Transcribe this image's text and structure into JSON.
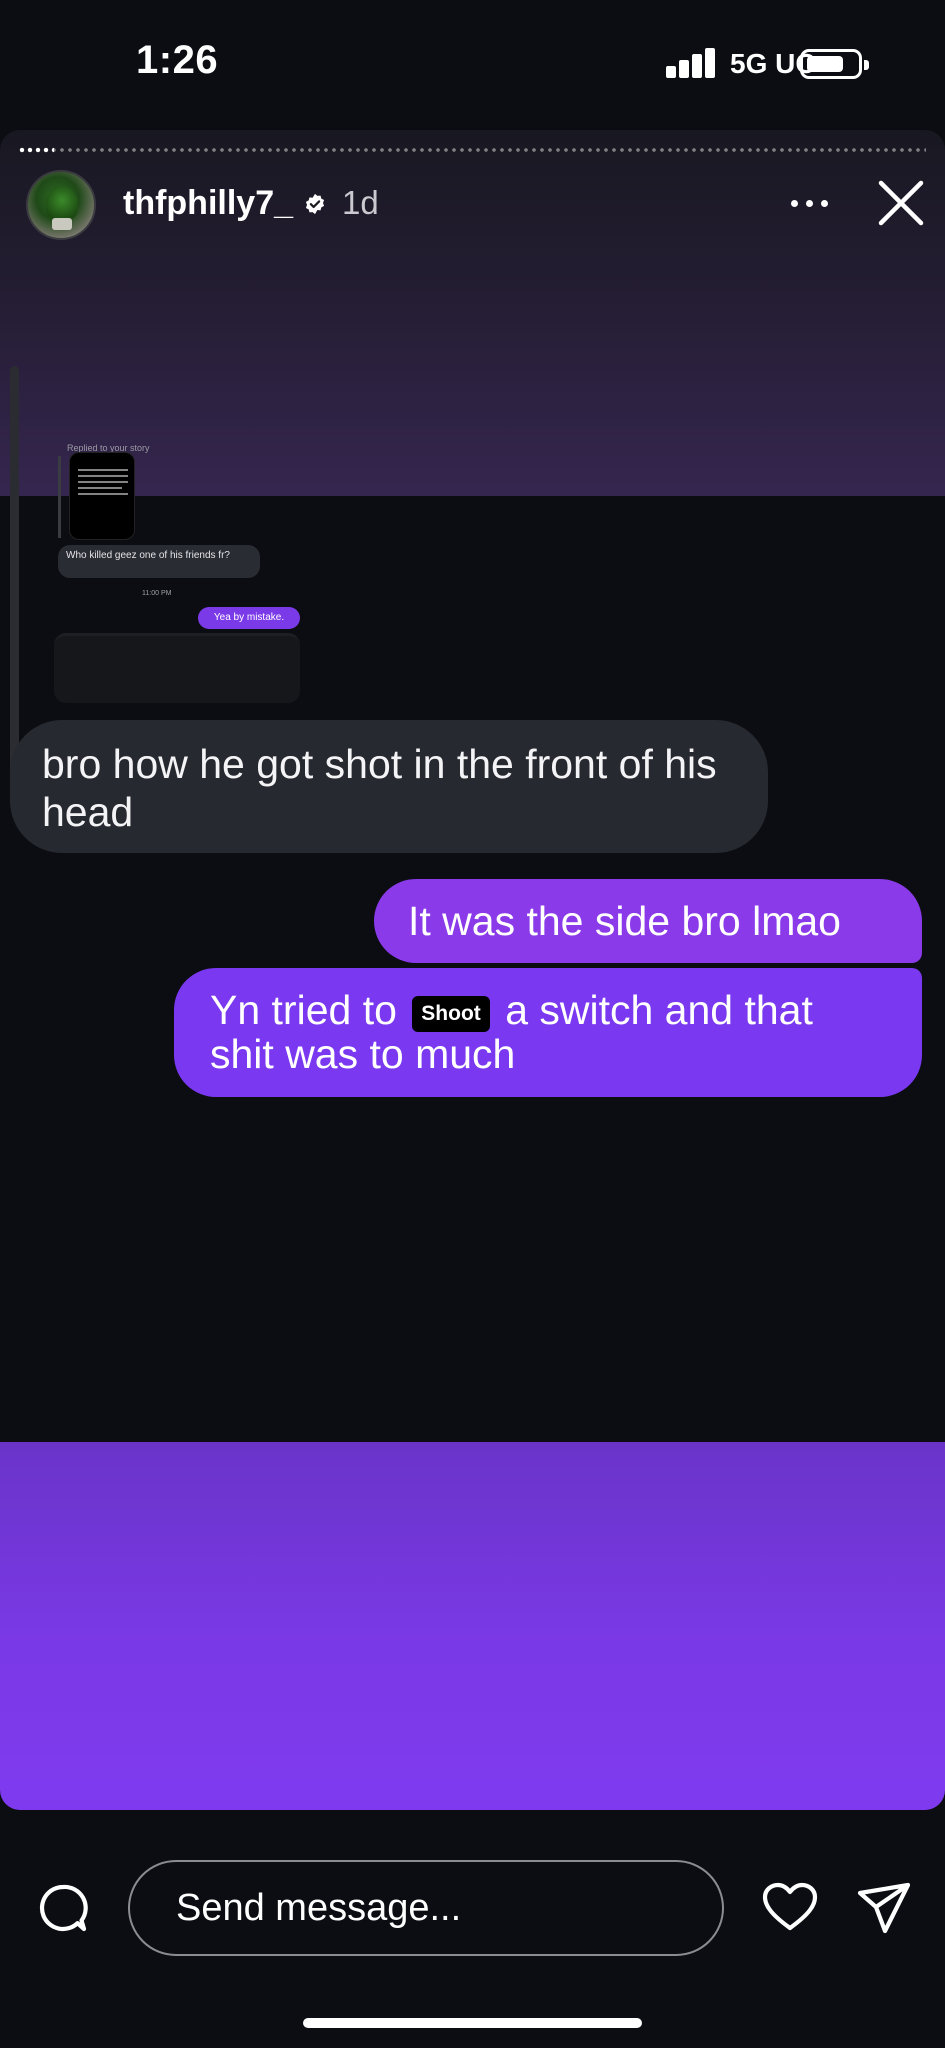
{
  "status_bar": {
    "time": "1:26",
    "network": "5G UC",
    "battery_level": 0.7
  },
  "story": {
    "username": "thfphilly7_",
    "verified": true,
    "time_ago": "1d",
    "progress_segments_done": 5,
    "embedded_screenshot": {
      "reply_label": "Replied to your story",
      "incoming_text": "Who killed geez one of his friends fr?",
      "timestamp": "11:00 PM",
      "outgoing_text": "Yea by mistake."
    },
    "messages": [
      {
        "direction": "incoming",
        "text": "bro how he got shot in the front of his head"
      },
      {
        "direction": "outgoing",
        "text": "It was the side bro lmao"
      },
      {
        "direction": "outgoing",
        "text_before": "Yn tried to",
        "sticker": "Shoot",
        "text_after": "a switch and that shit was to much"
      }
    ]
  },
  "reply_bar": {
    "placeholder": "Send message..."
  },
  "colors": {
    "background": "#0b0d12",
    "outgoing_bubble": "#8a3ae9",
    "incoming_bubble": "#26292f",
    "accent_purple": "#7f3aef"
  }
}
